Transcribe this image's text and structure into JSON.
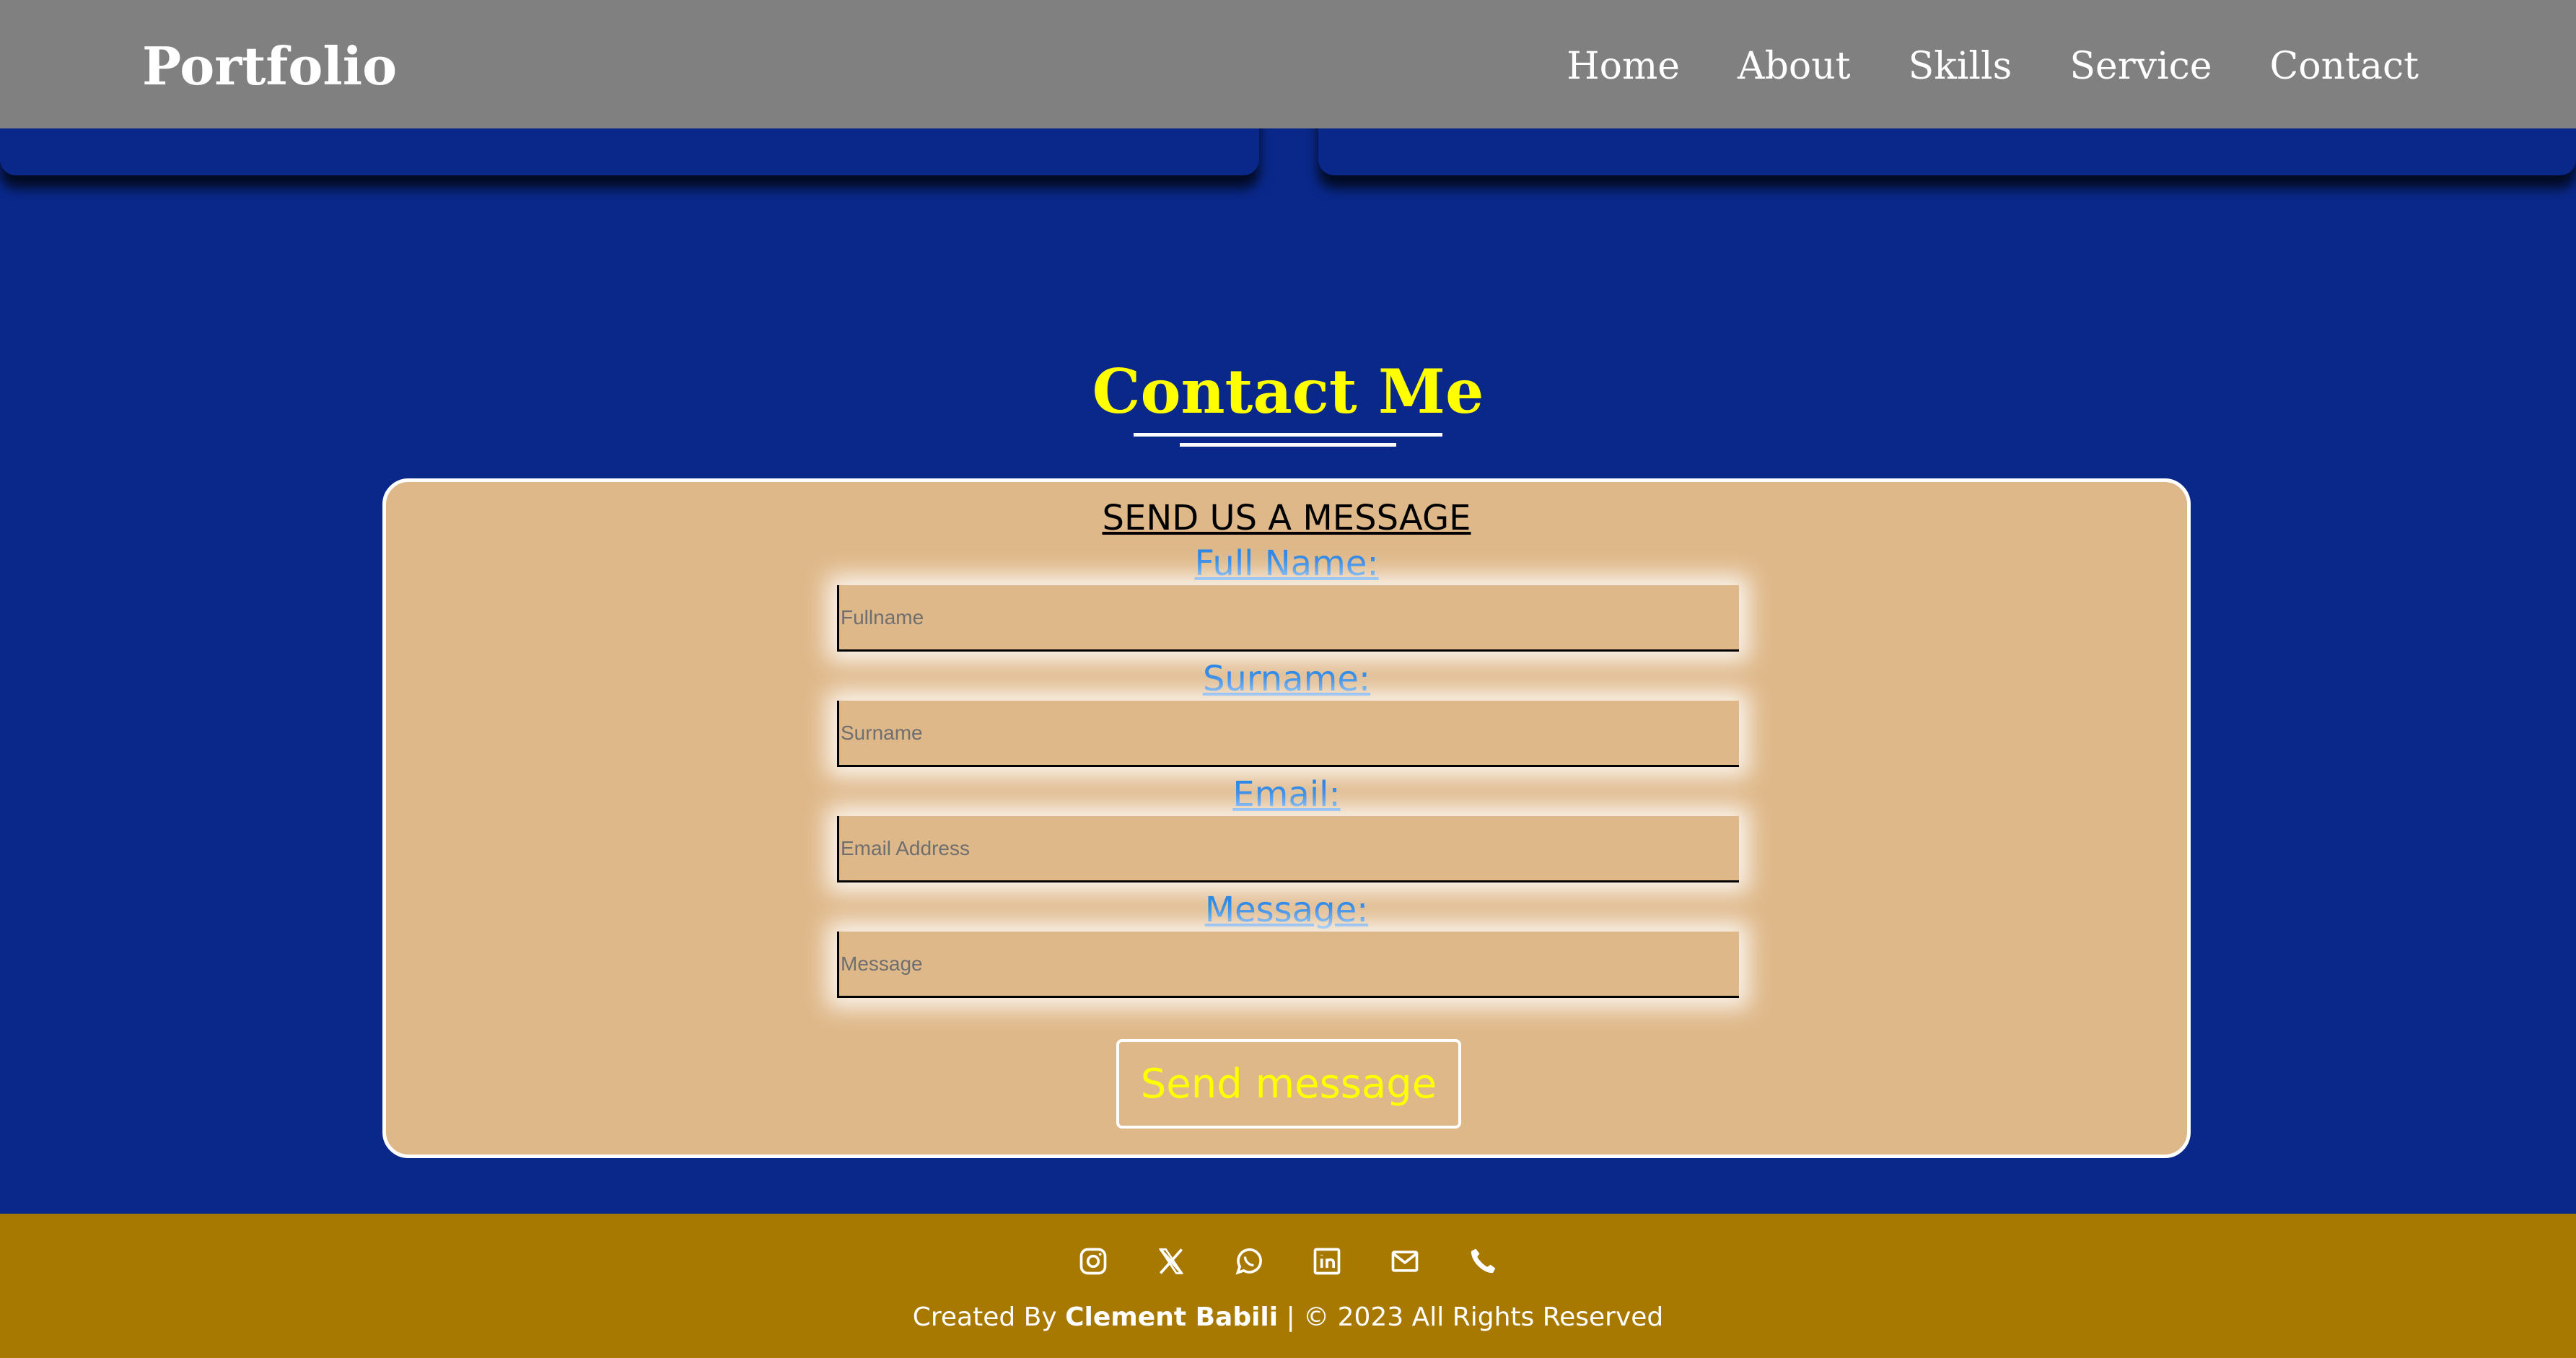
{
  "header": {
    "logo": "Portfolio",
    "nav": [
      "Home",
      "About",
      "Skills",
      "Service",
      "Contact"
    ]
  },
  "contact": {
    "title": "Contact Me",
    "form_heading": "SEND US A MESSAGE",
    "fields": [
      {
        "label": "Full Name:",
        "placeholder": "Fullname"
      },
      {
        "label": "Surname:",
        "placeholder": "Surname"
      },
      {
        "label": "Email:",
        "placeholder": "Email Address"
      },
      {
        "label": "Message:",
        "placeholder": "Message"
      }
    ],
    "submit_label": "Send message"
  },
  "footer": {
    "social_icons": [
      "instagram-icon",
      "x-twitter-icon",
      "whatsapp-icon",
      "linkedin-icon",
      "email-icon",
      "phone-icon"
    ],
    "credit_prefix": "Created By",
    "author": "Clement Babili",
    "copyright": "| © 2023 All Rights Reserved"
  },
  "colors": {
    "background": "#09288a",
    "header": "#808080",
    "footer": "#a87900",
    "form_bg": "#dfb889",
    "title": "#ffff00",
    "label": "#2b86e6"
  }
}
